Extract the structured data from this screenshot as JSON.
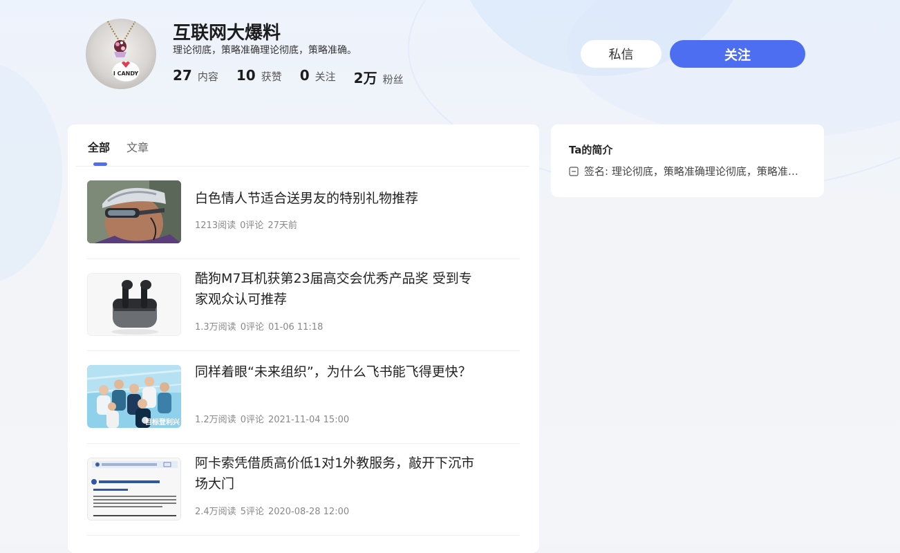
{
  "profile": {
    "name": "互联网大爆料",
    "bio": "理论彻底，策略准确理论彻底，策略准确。",
    "stats": [
      {
        "num": "27",
        "label": "内容"
      },
      {
        "num": "10",
        "label": "获赞"
      },
      {
        "num": "0",
        "label": "关注"
      },
      {
        "num": "2万",
        "label": "粉丝"
      }
    ],
    "avatar_text": "I CANDY"
  },
  "actions": {
    "message_label": "私信",
    "follow_label": "关注"
  },
  "tabs": [
    {
      "label": "全部",
      "active": true
    },
    {
      "label": "文章",
      "active": false
    }
  ],
  "feed": [
    {
      "title": "白色情人节适合送男友的特别礼物推荐",
      "reads": "1213阅读",
      "comments": "0评论",
      "time": "27天前",
      "thumb": "cyclist-photo"
    },
    {
      "title": "酷狗M7耳机获第23届高交会优秀产品奖 受到专家观众认可推荐",
      "reads": "1.3万阅读",
      "comments": "0评论",
      "time": "01-06 11:18",
      "thumb": "earbuds-photo"
    },
    {
      "title": "同样着眼“未来组织”，为什么飞书能飞得更快？",
      "reads": "1.2万阅读",
      "comments": "0评论",
      "time": "2021-11-04 15:00",
      "thumb": "team-photo",
      "thumb_caption": "目标登利兴"
    },
    {
      "title": "阿卡索凭借质高价低1对1外教服务，敲开下沉市场大门",
      "reads": "2.4万阅读",
      "comments": "5评论",
      "time": "2020-08-28 12:00",
      "thumb": "document-scan"
    }
  ],
  "sidebar": {
    "title": "Ta的简介",
    "signature_label": "签名:",
    "signature_text": "理论彻底，策略准确理论彻底，策略准确。"
  },
  "colors": {
    "accent": "#4e6ef2",
    "background": "#f3f4f8"
  }
}
